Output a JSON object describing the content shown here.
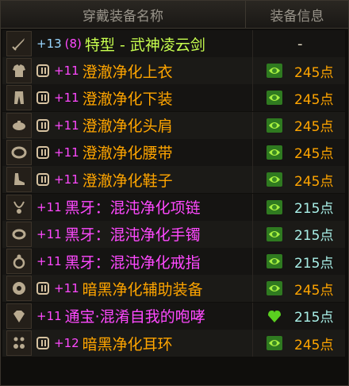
{
  "header": {
    "col_name": "穿戴装备名称",
    "col_info": "装备信息"
  },
  "weapon": {
    "level": "+13",
    "grade": "(8)",
    "name": "特型 - 武神凌云剑",
    "points": "-",
    "icon": "sword-icon"
  },
  "items": [
    {
      "slot": "coat",
      "icon": "coat-icon",
      "locked": true,
      "level": "+11",
      "name": "澄澈净化上衣",
      "points": "245点",
      "color": "orange",
      "pts_color": "orange",
      "gem": "green"
    },
    {
      "slot": "pants",
      "icon": "pants-icon",
      "locked": true,
      "level": "+11",
      "name": "澄澈净化下装",
      "points": "245点",
      "color": "orange",
      "pts_color": "orange",
      "gem": "green"
    },
    {
      "slot": "shoulder",
      "icon": "shoulder-icon",
      "locked": true,
      "level": "+11",
      "name": "澄澈净化头肩",
      "points": "245点",
      "color": "orange",
      "pts_color": "orange",
      "gem": "green"
    },
    {
      "slot": "belt",
      "icon": "belt-icon",
      "locked": true,
      "level": "+11",
      "name": "澄澈净化腰带",
      "points": "245点",
      "color": "orange",
      "pts_color": "orange",
      "gem": "green"
    },
    {
      "slot": "shoes",
      "icon": "shoes-icon",
      "locked": true,
      "level": "+11",
      "name": "澄澈净化鞋子",
      "points": "245点",
      "color": "orange",
      "pts_color": "orange",
      "gem": "green"
    },
    {
      "slot": "necklace",
      "icon": "necklace-icon",
      "locked": false,
      "level": "+11",
      "name": "黑牙：混沌净化项链",
      "points": "215点",
      "color": "mag",
      "pts_color": "cyan",
      "gem": "green"
    },
    {
      "slot": "bracelet",
      "icon": "bracelet-icon",
      "locked": false,
      "level": "+11",
      "name": "黑牙：混沌净化手镯",
      "points": "215点",
      "color": "mag",
      "pts_color": "cyan",
      "gem": "green"
    },
    {
      "slot": "ring",
      "icon": "ring-icon",
      "locked": false,
      "level": "+11",
      "name": "黑牙：混沌净化戒指",
      "points": "215点",
      "color": "mag",
      "pts_color": "cyan",
      "gem": "green"
    },
    {
      "slot": "support",
      "icon": "support-icon",
      "locked": true,
      "level": "+11",
      "name": "暗黑净化辅助装备",
      "points": "245点",
      "color": "orange",
      "pts_color": "orange",
      "gem": "green"
    },
    {
      "slot": "magic",
      "icon": "gem-stone-icon",
      "locked": false,
      "level": "+11",
      "name": "通宝·混淆自我的咆哮",
      "points": "215点",
      "color": "mag",
      "pts_color": "cyan",
      "gem": "heart"
    },
    {
      "slot": "earring",
      "icon": "earring-icon",
      "locked": true,
      "level": "+12",
      "name": "暗黑净化耳环",
      "points": "245点",
      "color": "orange",
      "pts_color": "orange",
      "gem": "green"
    }
  ],
  "colors": {
    "orange": "#ffa500",
    "magenta": "#ff49ff",
    "cyan": "#a9f0e8",
    "lime": "#c8ff4f"
  }
}
